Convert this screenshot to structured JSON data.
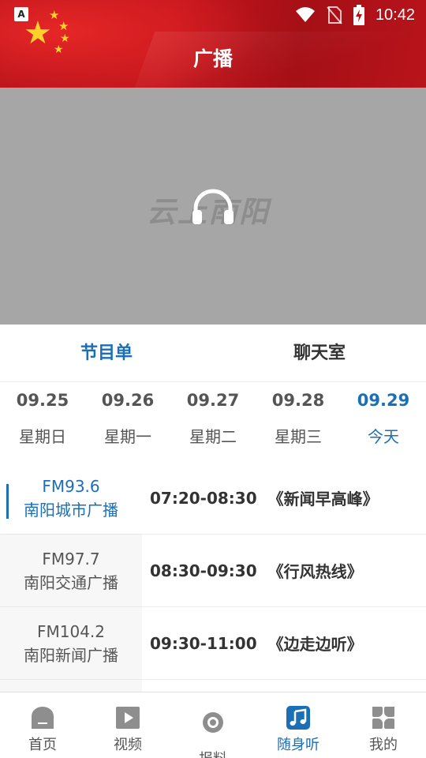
{
  "status_bar": {
    "time": "10:42",
    "app_badge": "A"
  },
  "header": {
    "title": "广播"
  },
  "player": {
    "watermark": "云上南阳",
    "icon": "headphones-icon"
  },
  "tabs": [
    {
      "label": "节目单",
      "active": true
    },
    {
      "label": "聊天室",
      "active": false
    }
  ],
  "dates": [
    {
      "date": "09.25",
      "day": "星期日"
    },
    {
      "date": "09.26",
      "day": "星期一"
    },
    {
      "date": "09.27",
      "day": "星期二"
    },
    {
      "date": "09.28",
      "day": "星期三"
    },
    {
      "date": "09.29",
      "day": "今天",
      "active": true
    }
  ],
  "stations": [
    {
      "freq": "FM93.6",
      "name": "南阳城市广播",
      "active": true
    },
    {
      "freq": "FM97.7",
      "name": "南阳交通广播"
    },
    {
      "freq": "FM104.2",
      "name": "南阳新闻广播"
    }
  ],
  "programs": [
    {
      "time": "07:20-08:30",
      "title": "《新闻早高峰》"
    },
    {
      "time": "08:30-09:30",
      "title": "《行风热线》"
    },
    {
      "time": "09:30-11:00",
      "title": "《边走边听》"
    }
  ],
  "bottom_nav": [
    {
      "label": "首页",
      "icon": "home-icon"
    },
    {
      "label": "视频",
      "icon": "video-icon"
    },
    {
      "label": "报料",
      "icon": "report-icon"
    },
    {
      "label": "随身听",
      "icon": "music-note-icon",
      "active": true
    },
    {
      "label": "我的",
      "icon": "grid-icon"
    }
  ],
  "colors": {
    "accent": "#1a6fb7",
    "header_red": "#c4161d",
    "player_bg": "#a6a6a6"
  }
}
